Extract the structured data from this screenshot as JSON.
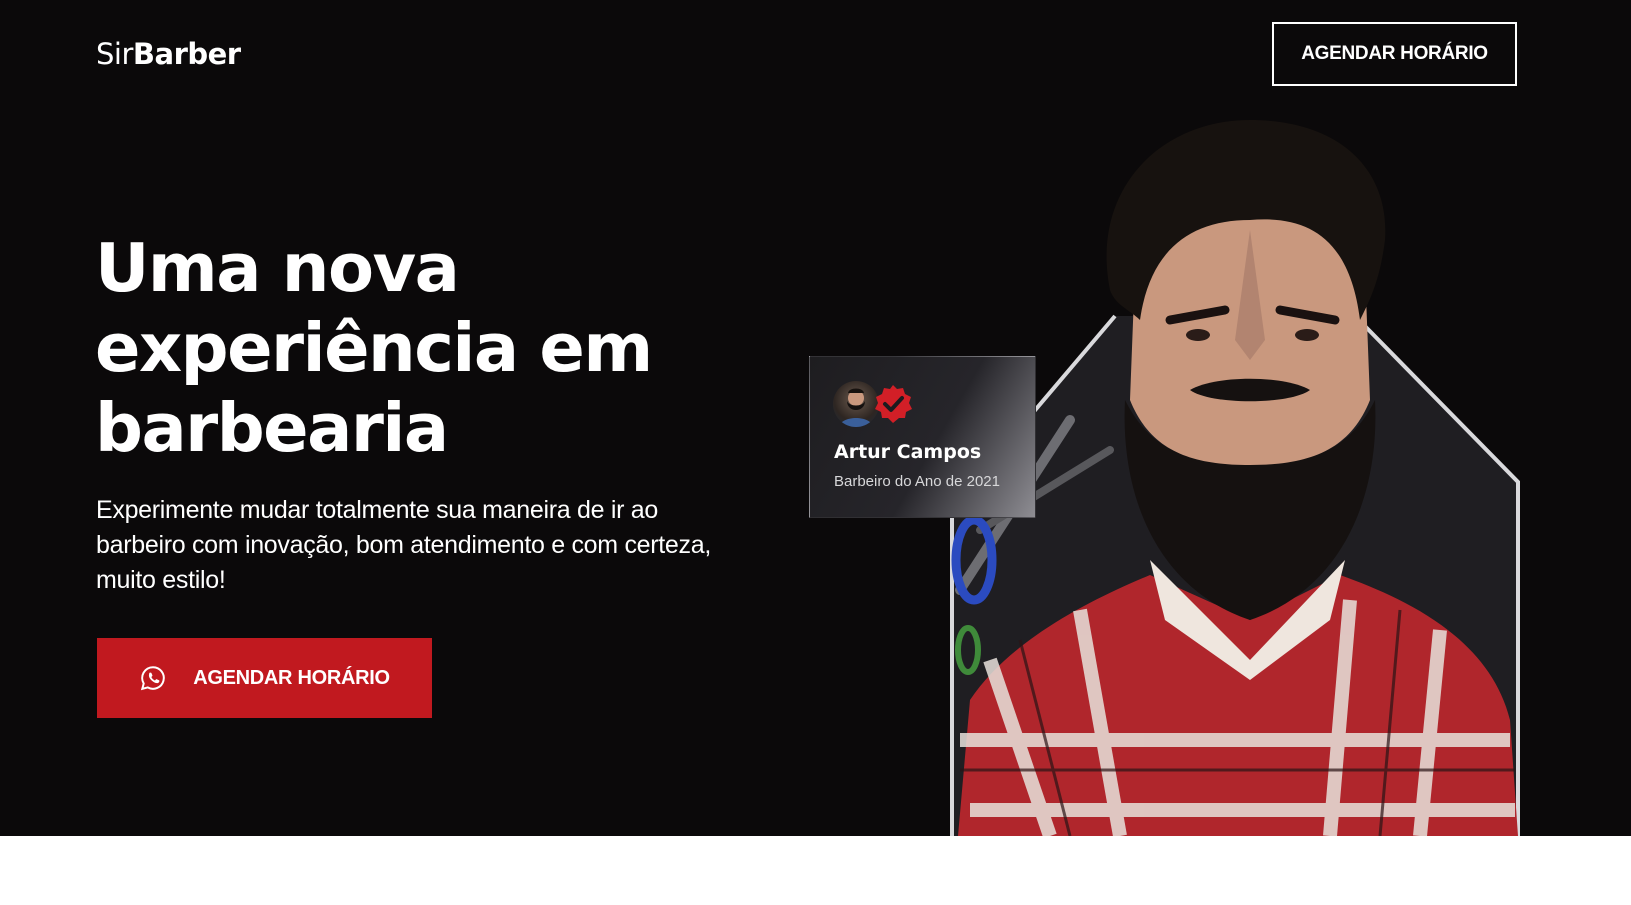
{
  "brand": {
    "logo_light": "Sir",
    "logo_bold": "Barber"
  },
  "header": {
    "cta_label": "AGENDAR HORÁRIO"
  },
  "hero": {
    "headline_line1": "Uma nova",
    "headline_line2": "experiência em",
    "headline_line3": "barbearia",
    "subtext": "Experimente mudar totalmente sua maneira de ir ao barbeiro com inovação, bom atendimento e com certeza, muito estilo!",
    "cta_label": "AGENDAR HORÁRIO",
    "cta_icon": "whatsapp-icon"
  },
  "badge": {
    "name": "Artur Campos",
    "role": "Barbeiro do Ano de 2021",
    "verified_icon": "verified-check-icon"
  },
  "colors": {
    "background": "#0b090a",
    "accent": "#c1191f",
    "text": "#ffffff",
    "bottom_band": "#ffffff"
  }
}
